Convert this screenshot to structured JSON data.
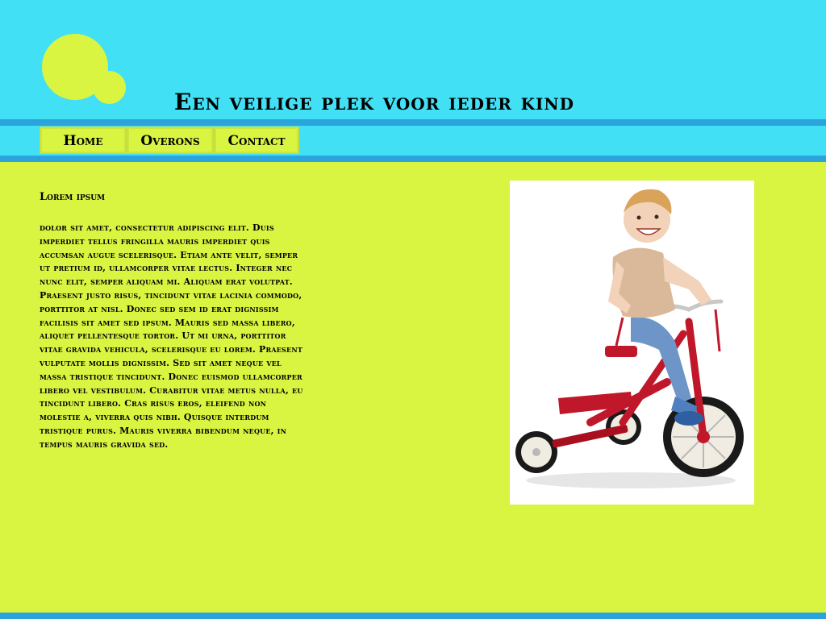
{
  "header": {
    "title": "Een veilige plek voor ieder kind"
  },
  "nav": {
    "items": [
      {
        "label": "Home"
      },
      {
        "label": "Overons"
      },
      {
        "label": "Contact"
      }
    ]
  },
  "content": {
    "heading": "Lorem ipsum",
    "body": " dolor sit amet, consectetur adipiscing elit. Duis imperdiet tellus fringilla mauris imperdiet quis accumsan augue scelerisque. Etiam ante velit, semper ut pretium id, ullamcorper vitae lectus. Integer nec nunc elit, semper aliquam mi. Aliquam erat volutpat. Praesent justo risus, tincidunt vitae lacinia commodo, porttitor at nisl. Donec sed sem id erat dignissim facilisis sit amet sed ipsum. Mauris sed massa libero, aliquet pellentesque tortor. Ut mi urna, porttitor vitae gravida vehicula, scelerisque eu lorem. Praesent vulputate mollis dignissim. Sed sit amet neque vel massa tristique tincidunt. Donec euismod ullamcorper libero vel vestibulum. Curabitur vitae metus nulla, eu tincidunt libero. Cras risus eros, eleifend non molestie a, viverra quis nibh. Quisque interdum tristique purus. Mauris viverra bibendum neque, in tempus mauris gravida sed."
  },
  "colors": {
    "cyan": "#42e0f5",
    "lime": "#d9f542",
    "band_blue": "#2ba3dc"
  },
  "icons": {
    "logo": "two-circles-logo",
    "photo": "child-on-tricycle-photo"
  }
}
